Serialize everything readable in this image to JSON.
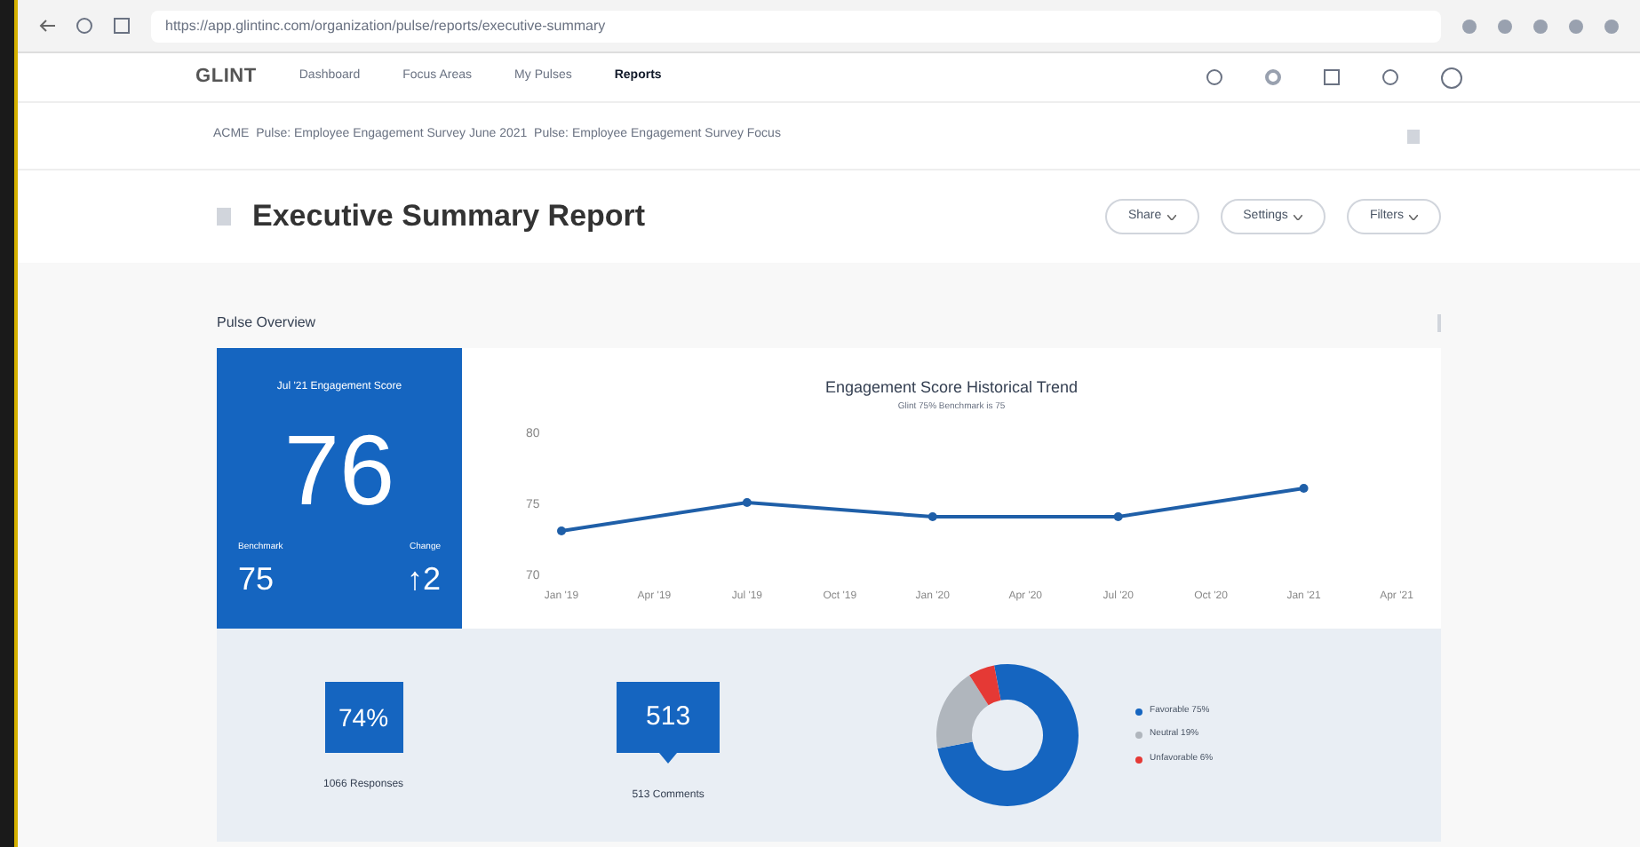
{
  "browser": {
    "url": "https://app.glintinc.com/organization/pulse/reports/executive-summary"
  },
  "nav": {
    "logo": "GLINT",
    "items": [
      {
        "label": "Dashboard",
        "selected": false
      },
      {
        "label": "Focus Areas",
        "selected": false
      },
      {
        "label": "My Pulses",
        "selected": false
      },
      {
        "label": "Reports",
        "selected": true
      }
    ]
  },
  "breadcrumb": "ACME  Pulse: Employee Engagement Survey June 2021  Pulse: Employee Engagement Survey Focus",
  "header": {
    "title": "Executive Summary Report",
    "buttons": [
      "Share",
      "Settings",
      "Filters"
    ]
  },
  "section": {
    "title": "Pulse Overview"
  },
  "score_card": {
    "label": "Jul '21 Engagement Score",
    "score": "76",
    "benchmark_label": "Benchmark",
    "benchmark": "75",
    "change_label": "Change",
    "change": "↑2"
  },
  "trend": {
    "chart_data": {
      "type": "line",
      "title": "Engagement Score Historical Trend",
      "subtitle": "Glint 75% Benchmark is 75",
      "categories": [
        "Jan '19",
        "Apr '19",
        "Jul '19",
        "Oct '19",
        "Jan '20",
        "Apr '20",
        "Jul '20",
        "Oct '20",
        "Jan '21",
        "Apr '21"
      ],
      "series": [
        {
          "color": "#1f5fa8",
          "marker": true,
          "values": [
            73,
            null,
            75,
            null,
            74,
            null,
            74,
            null,
            76,
            null
          ]
        }
      ],
      "ylim": [
        70,
        80
      ],
      "yticks": [
        70,
        75,
        80
      ]
    }
  },
  "stats": [
    {
      "kind": "percent",
      "value": "74%",
      "label": "1066 Responses"
    },
    {
      "kind": "comments",
      "value": "513",
      "label": "513 Comments"
    }
  ],
  "distribution": {
    "chart_data": {
      "type": "donut",
      "categories": [
        "Favorable 75%",
        "Neutral 19%",
        "Unfavorable 6%"
      ],
      "series": [
        {
          "values": [
            75,
            19,
            6
          ]
        }
      ],
      "colors": [
        "#1565c0",
        "#b0b6bd",
        "#e53935"
      ]
    }
  }
}
